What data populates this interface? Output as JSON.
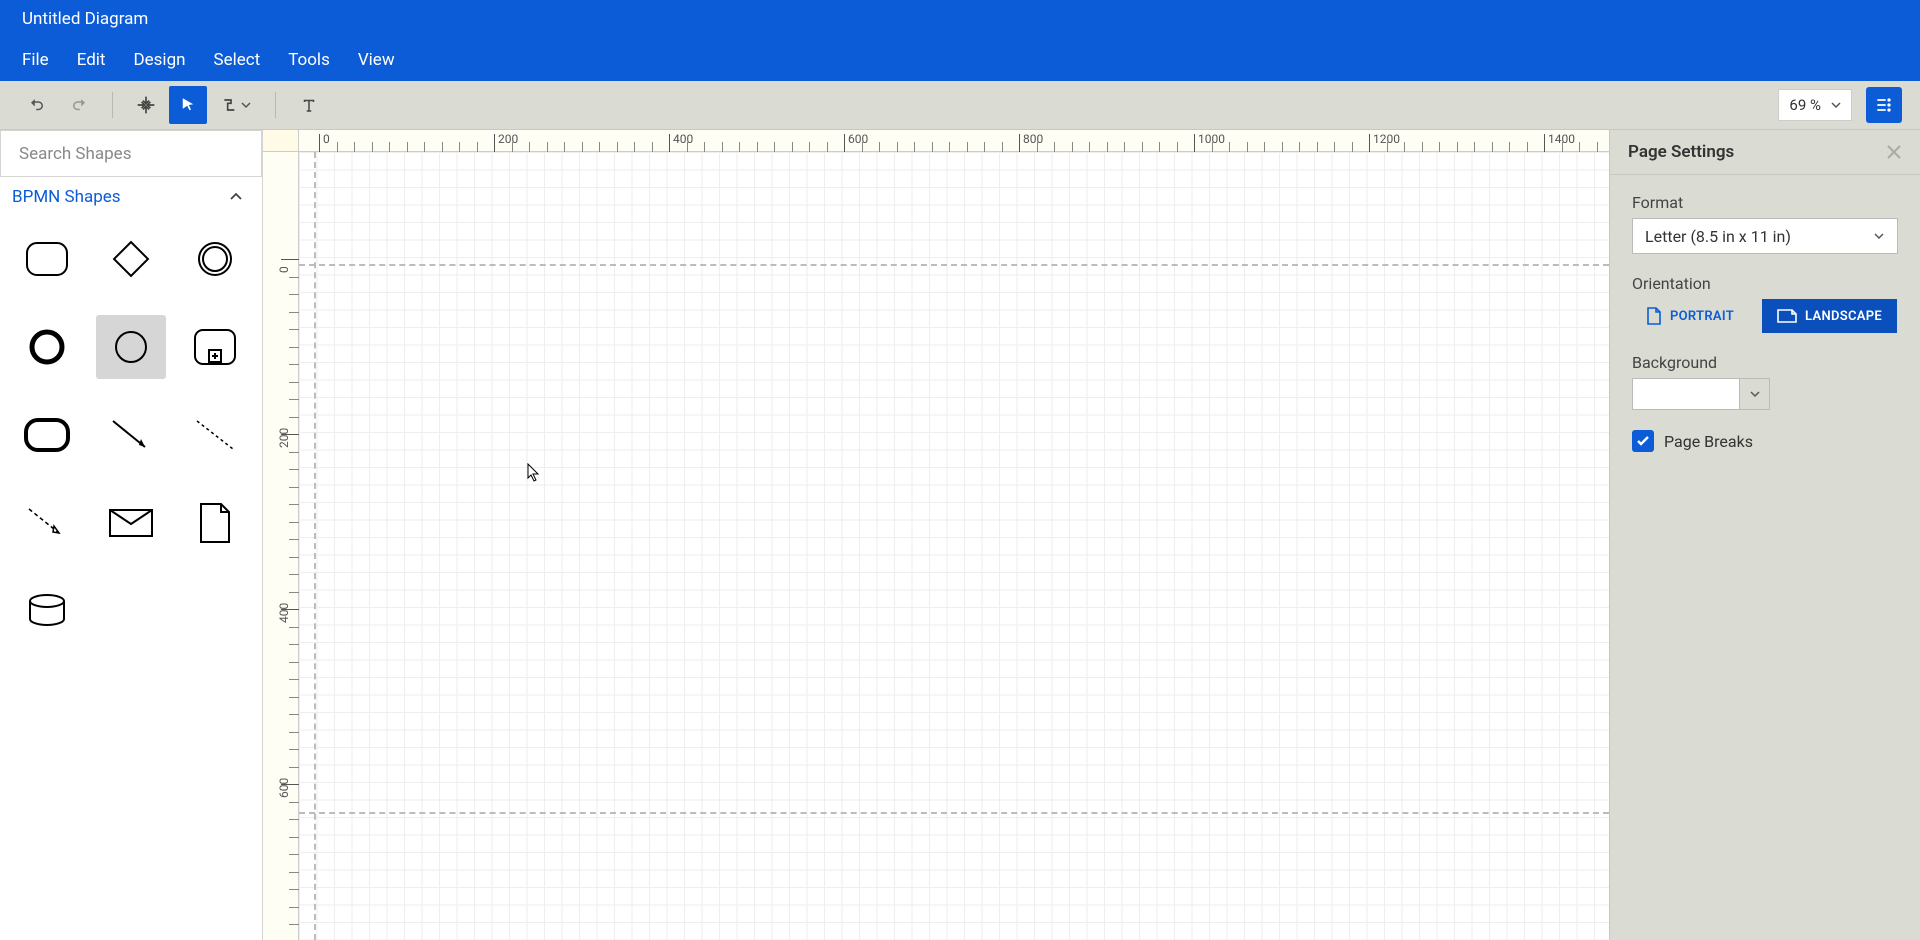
{
  "title": "Untitled Diagram",
  "menu": {
    "file": "File",
    "edit": "Edit",
    "design": "Design",
    "select": "Select",
    "tools": "Tools",
    "view": "View"
  },
  "toolbar": {
    "zoom": "69 %"
  },
  "shapes": {
    "search_placeholder": "Search Shapes",
    "group_label": "BPMN Shapes"
  },
  "ruler": {
    "h": [
      "0",
      "200",
      "400",
      "600",
      "800",
      "1000",
      "1200",
      "1400"
    ],
    "v": [
      "0",
      "200",
      "400",
      "600"
    ]
  },
  "settings": {
    "title": "Page Settings",
    "format_label": "Format",
    "format_value": "Letter (8.5 in x 11 in)",
    "orientation_label": "Orientation",
    "portrait": "PORTRAIT",
    "landscape": "LANDSCAPE",
    "background_label": "Background",
    "pagebreaks_label": "Page Breaks",
    "pagebreaks_checked": true
  }
}
